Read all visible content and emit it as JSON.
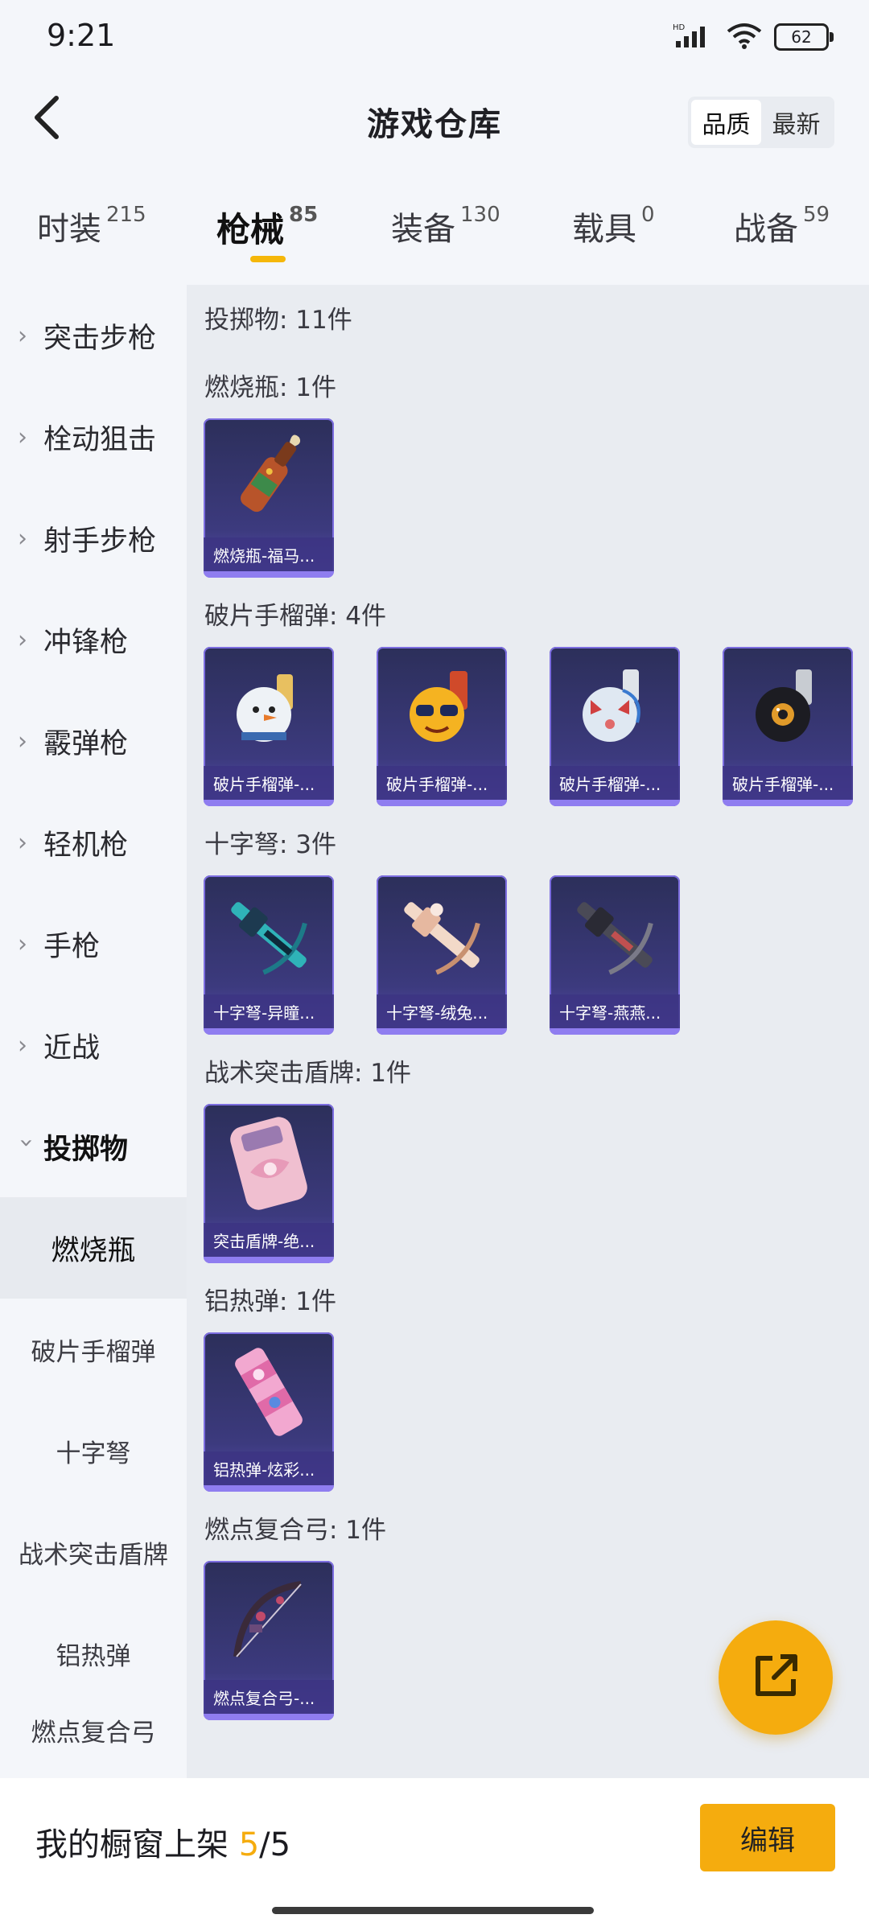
{
  "status_bar": {
    "time": "9:21",
    "network": "HD",
    "battery": "62"
  },
  "header": {
    "title": "游戏仓库",
    "sort_options": [
      "品质",
      "最新"
    ],
    "sort_selected": "品质"
  },
  "tabs": [
    {
      "label": "时装",
      "count": "215",
      "active": false
    },
    {
      "label": "枪械",
      "count": "85",
      "active": true
    },
    {
      "label": "装备",
      "count": "130",
      "active": false
    },
    {
      "label": "载具",
      "count": "0",
      "active": false
    },
    {
      "label": "战备",
      "count": "59",
      "active": false
    }
  ],
  "sidebar": {
    "items": [
      "突击步枪",
      "栓动狙击",
      "射手步枪",
      "冲锋枪",
      "霰弹枪",
      "轻机枪",
      "手枪",
      "近战",
      "投掷物"
    ],
    "expanded": "投掷物",
    "sub_items": [
      "燃烧瓶",
      "破片手榴弹",
      "十字弩",
      "战术突击盾牌",
      "铝热弹",
      "燃点复合弓"
    ],
    "selected_sub": "燃烧瓶"
  },
  "content": {
    "summary": "投掷物: 11件",
    "groups": [
      {
        "label": "燃烧瓶: 1件",
        "cards": [
          "燃烧瓶-福马..."
        ]
      },
      {
        "label": "破片手榴弹: 4件",
        "cards": [
          "破片手榴弹-...",
          "破片手榴弹-...",
          "破片手榴弹-...",
          "破片手榴弹-..."
        ]
      },
      {
        "label": "十字弩: 3件",
        "cards": [
          "十字弩-异瞳...",
          "十字弩-绒兔...",
          "十字弩-燕燕..."
        ]
      },
      {
        "label": "战术突击盾牌: 1件",
        "cards": [
          "突击盾牌-绝..."
        ]
      },
      {
        "label": "铝热弹: 1件",
        "cards": [
          "铝热弹-炫彩..."
        ]
      },
      {
        "label": "燃点复合弓: 1件",
        "cards": [
          "燃点复合弓-..."
        ]
      }
    ]
  },
  "bottom_bar": {
    "label": "我的橱窗上架",
    "current": "5",
    "separator": "/",
    "total": "5",
    "edit_button": "编辑"
  },
  "colors": {
    "accent": "#f5ac0e",
    "card_bg": "#3c3a7e",
    "card_border": "#7c6de0"
  },
  "icons": {
    "back": "back-chevron-icon",
    "fab": "share-external-icon"
  }
}
